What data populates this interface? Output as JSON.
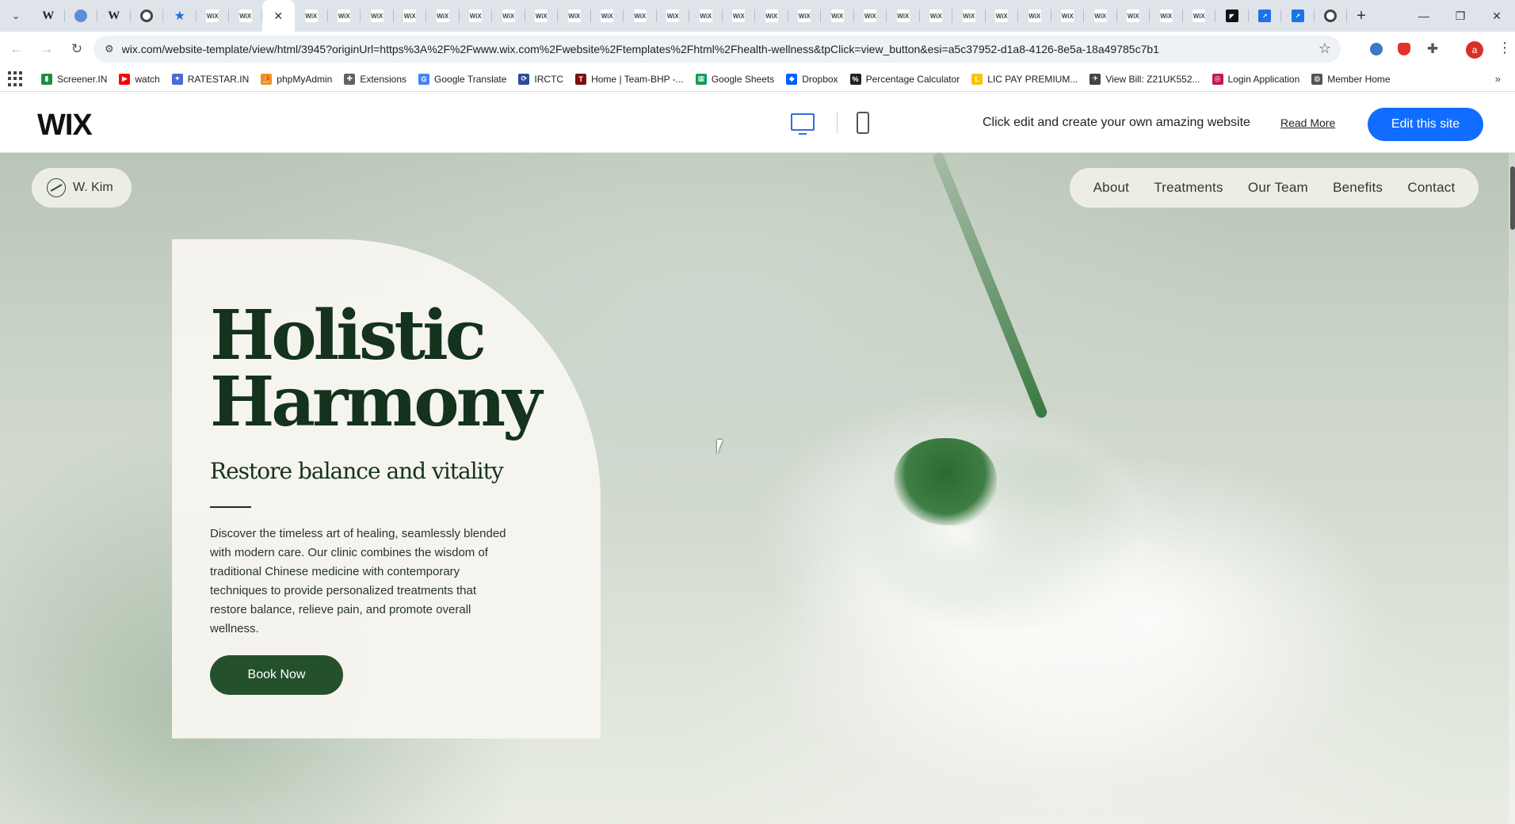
{
  "browser": {
    "tabs": [
      {
        "icon": "wikipedia-icon",
        "label": "W"
      },
      {
        "icon": "globe-icon",
        "label": ""
      },
      {
        "icon": "wikipedia-icon",
        "label": "W"
      },
      {
        "icon": "chatgpt-icon",
        "label": ""
      },
      {
        "icon": "star-icon",
        "label": "★"
      },
      {
        "icon": "wix-icon",
        "label": "WiX"
      },
      {
        "icon": "wix-icon",
        "label": "WiX"
      },
      {
        "icon": "close-icon",
        "label": "✕",
        "active": true
      },
      {
        "icon": "wix-icon",
        "label": "WiX"
      },
      {
        "icon": "wix-icon",
        "label": "WiX"
      },
      {
        "icon": "wix-icon",
        "label": "WiX"
      },
      {
        "icon": "wix-icon",
        "label": "WiX"
      },
      {
        "icon": "wix-icon",
        "label": "WiX"
      },
      {
        "icon": "wix-icon",
        "label": "WiX"
      },
      {
        "icon": "wix-icon",
        "label": "WiX"
      },
      {
        "icon": "wix-icon",
        "label": "WiX"
      },
      {
        "icon": "wix-icon",
        "label": "WiX"
      },
      {
        "icon": "wix-icon",
        "label": "WiX"
      },
      {
        "icon": "wix-icon",
        "label": "WiX"
      },
      {
        "icon": "wix-icon",
        "label": "WiX"
      },
      {
        "icon": "wix-icon",
        "label": "WiX"
      },
      {
        "icon": "wix-icon",
        "label": "WiX"
      },
      {
        "icon": "wix-icon",
        "label": "WiX"
      },
      {
        "icon": "wix-icon",
        "label": "WiX"
      },
      {
        "icon": "wix-icon",
        "label": "WiX"
      },
      {
        "icon": "wix-icon",
        "label": "WiX"
      },
      {
        "icon": "wix-icon",
        "label": "WiX"
      },
      {
        "icon": "wix-icon",
        "label": "WiX"
      },
      {
        "icon": "wix-icon",
        "label": "WiX"
      },
      {
        "icon": "wix-icon",
        "label": "WiX"
      },
      {
        "icon": "wix-icon",
        "label": "WiX"
      },
      {
        "icon": "wix-icon",
        "label": "WiX"
      },
      {
        "icon": "wix-icon",
        "label": "WiX"
      },
      {
        "icon": "wix-icon",
        "label": "WiX"
      },
      {
        "icon": "wix-icon",
        "label": "WiX"
      },
      {
        "icon": "wix-icon",
        "label": "WiX"
      },
      {
        "icon": "dark-app-icon",
        "label": "◤"
      },
      {
        "icon": "blue-app-icon",
        "label": "↗"
      },
      {
        "icon": "blue-app-icon",
        "label": "↗"
      },
      {
        "icon": "chrome-icon",
        "label": ""
      }
    ],
    "new_tab": "+",
    "window_controls": {
      "minimize": "—",
      "restore": "❐",
      "close": "✕"
    },
    "url": "wix.com/website-template/view/html/3945?originUrl=https%3A%2F%2Fwww.wix.com%2Fwebsite%2Ftemplates%2Fhtml%2Fhealth-wellness&tpClick=view_button&esi=a5c37952-d1a8-4126-8e5a-18a49785c7b1",
    "profile_initial": "a",
    "bookmarks": [
      {
        "label": "Screener.IN",
        "icon": "bar-chart-icon",
        "color": "#1e8e3e",
        "glyph": "▮"
      },
      {
        "label": "watch",
        "icon": "youtube-icon",
        "color": "#ff0000",
        "glyph": "▶"
      },
      {
        "label": "RATESTAR.IN",
        "icon": "ratestar-icon",
        "color": "#4a6cd4",
        "glyph": "✦"
      },
      {
        "label": "phpMyAdmin",
        "icon": "phpmyadmin-icon",
        "color": "#f29111",
        "glyph": "⛵"
      },
      {
        "label": "Extensions",
        "icon": "puzzle-icon",
        "color": "#5f6368",
        "glyph": "✚"
      },
      {
        "label": "Google Translate",
        "icon": "translate-icon",
        "color": "#4285f4",
        "glyph": "G"
      },
      {
        "label": "IRCTC",
        "icon": "irctc-icon",
        "color": "#2b4c9b",
        "glyph": "⟳"
      },
      {
        "label": "Home | Team-BHP -...",
        "icon": "teambhp-icon",
        "color": "#7a1010",
        "glyph": "T"
      },
      {
        "label": "Google Sheets",
        "icon": "sheets-icon",
        "color": "#0f9d58",
        "glyph": "▦"
      },
      {
        "label": "Dropbox",
        "icon": "dropbox-icon",
        "color": "#0061ff",
        "glyph": "◆"
      },
      {
        "label": "Percentage Calculator",
        "icon": "percent-icon",
        "color": "#222222",
        "glyph": "%"
      },
      {
        "label": "LIC PAY PREMIUM...",
        "icon": "lic-icon",
        "color": "#f7c600",
        "glyph": "L"
      },
      {
        "label": "View Bill: Z21UK552...",
        "icon": "bill-icon",
        "color": "#444444",
        "glyph": "✈"
      },
      {
        "label": "Login Application",
        "icon": "login-icon",
        "color": "#c2185b",
        "glyph": "◎"
      },
      {
        "label": "Member Home",
        "icon": "globe-icon",
        "color": "#555555",
        "glyph": "◍"
      }
    ]
  },
  "wix_header": {
    "logo": "WIX",
    "tagline": "Click edit and create your own amazing website",
    "read_more": "Read More",
    "edit_button": "Edit this site",
    "accent": "#116dff"
  },
  "site": {
    "logo_text": "W. Kim",
    "nav": [
      "About",
      "Treatments",
      "Our Team",
      "Benefits",
      "Contact"
    ],
    "headline_line1": "Holistic",
    "headline_line2": "Harmony",
    "subheadline": "Restore balance and vitality",
    "body": "Discover the timeless art of healing, seamlessly blended with modern care. Our clinic combines the wisdom of traditional Chinese medicine with contemporary techniques to provide personalized treatments that restore balance, relieve pain, and promote overall wellness.",
    "cta": "Book Now",
    "colors": {
      "primary": "#24512c",
      "text": "#14321c",
      "card": "#f7f5ef"
    }
  }
}
